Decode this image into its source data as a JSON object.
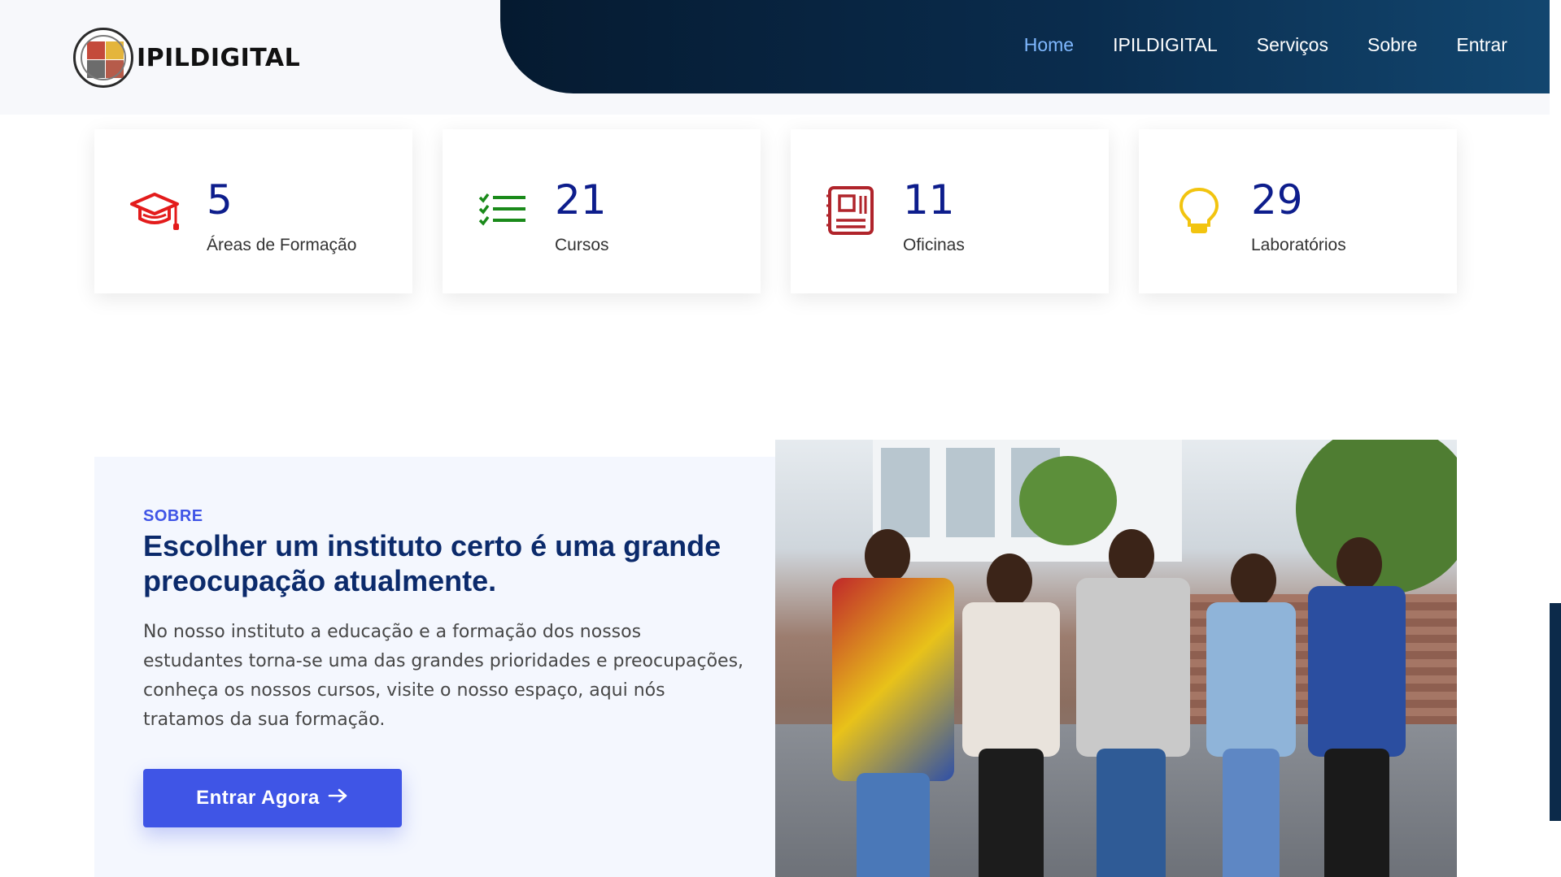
{
  "header": {
    "brand_name": "IPILDIGITAL",
    "nav": [
      {
        "label": "Home",
        "active": true
      },
      {
        "label": "IPILDIGITAL"
      },
      {
        "label": "Serviços"
      },
      {
        "label": "Sobre"
      },
      {
        "label": "Entrar"
      }
    ]
  },
  "stats": [
    {
      "value": "5",
      "label": "Áreas de Formação",
      "icon": "graduation-cap-icon",
      "color": "#e31b1b"
    },
    {
      "value": "21",
      "label": "Cursos",
      "icon": "checklist-icon",
      "color": "#1a8a1a"
    },
    {
      "value": "11",
      "label": "Oficinas",
      "icon": "circuit-notebook-icon",
      "color": "#b0242b"
    },
    {
      "value": "29",
      "label": "Laboratórios",
      "icon": "lightbulb-icon",
      "color": "#f2c40f"
    }
  ],
  "about": {
    "kicker": "SOBRE",
    "headline": "Escolher um instituto certo é uma grande preocupação atualmente.",
    "description": "No nosso instituto a educação e a formação dos nossos estudantes torna-se uma das grandes prioridades e preocupações, conheça os nossos cursos, visite o nosso espaço, aqui nós tratamos da sua formação.",
    "cta_label": "Entrar Agora",
    "accent": "#3f55e6"
  }
}
